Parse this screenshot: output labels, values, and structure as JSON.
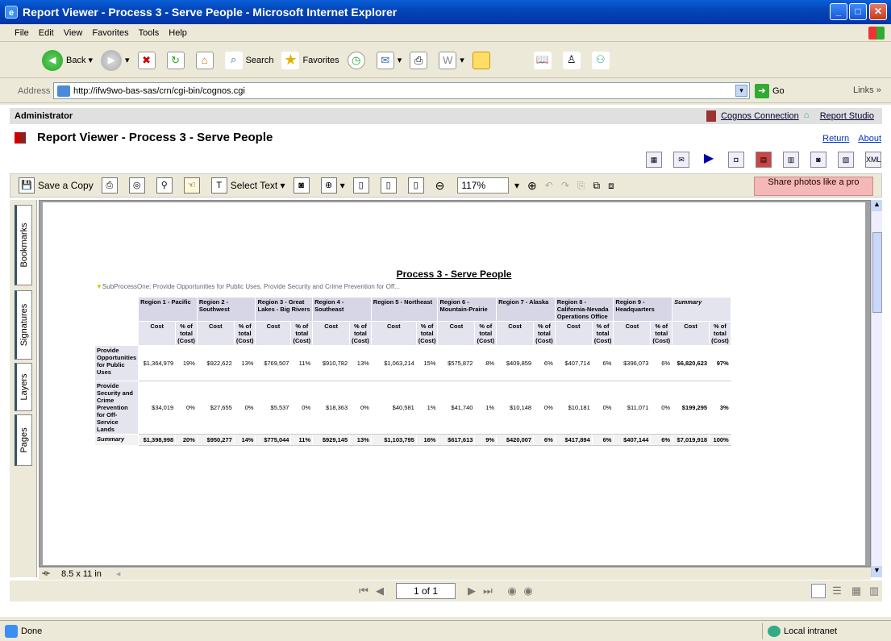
{
  "window": {
    "title": "Report Viewer - Process 3 - Serve People - Microsoft Internet Explorer"
  },
  "menu": [
    "File",
    "Edit",
    "View",
    "Favorites",
    "Tools",
    "Help"
  ],
  "toolbar": {
    "back": "Back",
    "search": "Search",
    "favorites": "Favorites"
  },
  "address": {
    "label": "Address",
    "url": "http://ifw9wo-bas-sas/crn/cgi-bin/cognos.cgi",
    "go": "Go",
    "links": "Links"
  },
  "admin": {
    "user": "Administrator",
    "cognos_connection": "Cognos Connection",
    "report_studio": "Report Studio"
  },
  "viewer": {
    "title": "Report Viewer - Process 3 - Serve People",
    "return": "Return",
    "about": "About"
  },
  "pdf": {
    "save_copy": "Save a Copy",
    "select_text": "Select Text",
    "zoom": "117%",
    "share": "Share photos like a pro"
  },
  "sidetabs": [
    "Bookmarks",
    "Signatures",
    "Layers",
    "Pages"
  ],
  "page_size": "8.5 x 11 in",
  "page_nav": "1 of 1",
  "status": {
    "left": "Done",
    "zone": "Local intranet"
  },
  "report": {
    "title": "Process 3 - Serve People",
    "filter": "SubProcessOne: Provide Opportunities for Public Uses, Provide Security and Crime Prevention for Off...",
    "regions": [
      "Region 1 - Pacific",
      "Region 2 - Southwest",
      "Region 3 - Great Lakes - Big Rivers",
      "Region 4 - Southeast",
      "Region 5 - Northeast",
      "Region 6 - Mountain-Prairie",
      "Region 7 - Alaska",
      "Region 8 - California-Nevada Operations Office",
      "Region 9 - Headquarters",
      "Summary"
    ],
    "col_cost": "Cost",
    "col_pct": "% of total (Cost)",
    "rows": [
      {
        "label": "Provide Opportunities for Public Uses",
        "values": [
          "$1,364,979",
          "19%",
          "$922,622",
          "13%",
          "$769,507",
          "11%",
          "$910,782",
          "13%",
          "$1,063,214",
          "15%",
          "$575,872",
          "8%",
          "$409,859",
          "6%",
          "$407,714",
          "6%",
          "$396,073",
          "6%",
          "$6,820,623",
          "97%"
        ]
      },
      {
        "label": "Provide Security and Crime Prevention for Off-Service Lands",
        "values": [
          "$34,019",
          "0%",
          "$27,655",
          "0%",
          "$5,537",
          "0%",
          "$18,363",
          "0%",
          "$40,581",
          "1%",
          "$41,740",
          "1%",
          "$10,148",
          "0%",
          "$10,181",
          "0%",
          "$11,071",
          "0%",
          "$199,295",
          "3%"
        ]
      },
      {
        "label": "Summary",
        "values": [
          "$1,398,998",
          "20%",
          "$950,277",
          "14%",
          "$775,044",
          "11%",
          "$929,145",
          "13%",
          "$1,103,795",
          "16%",
          "$617,613",
          "9%",
          "$420,007",
          "6%",
          "$417,894",
          "6%",
          "$407,144",
          "6%",
          "$7,019,918",
          "100%"
        ]
      }
    ]
  }
}
